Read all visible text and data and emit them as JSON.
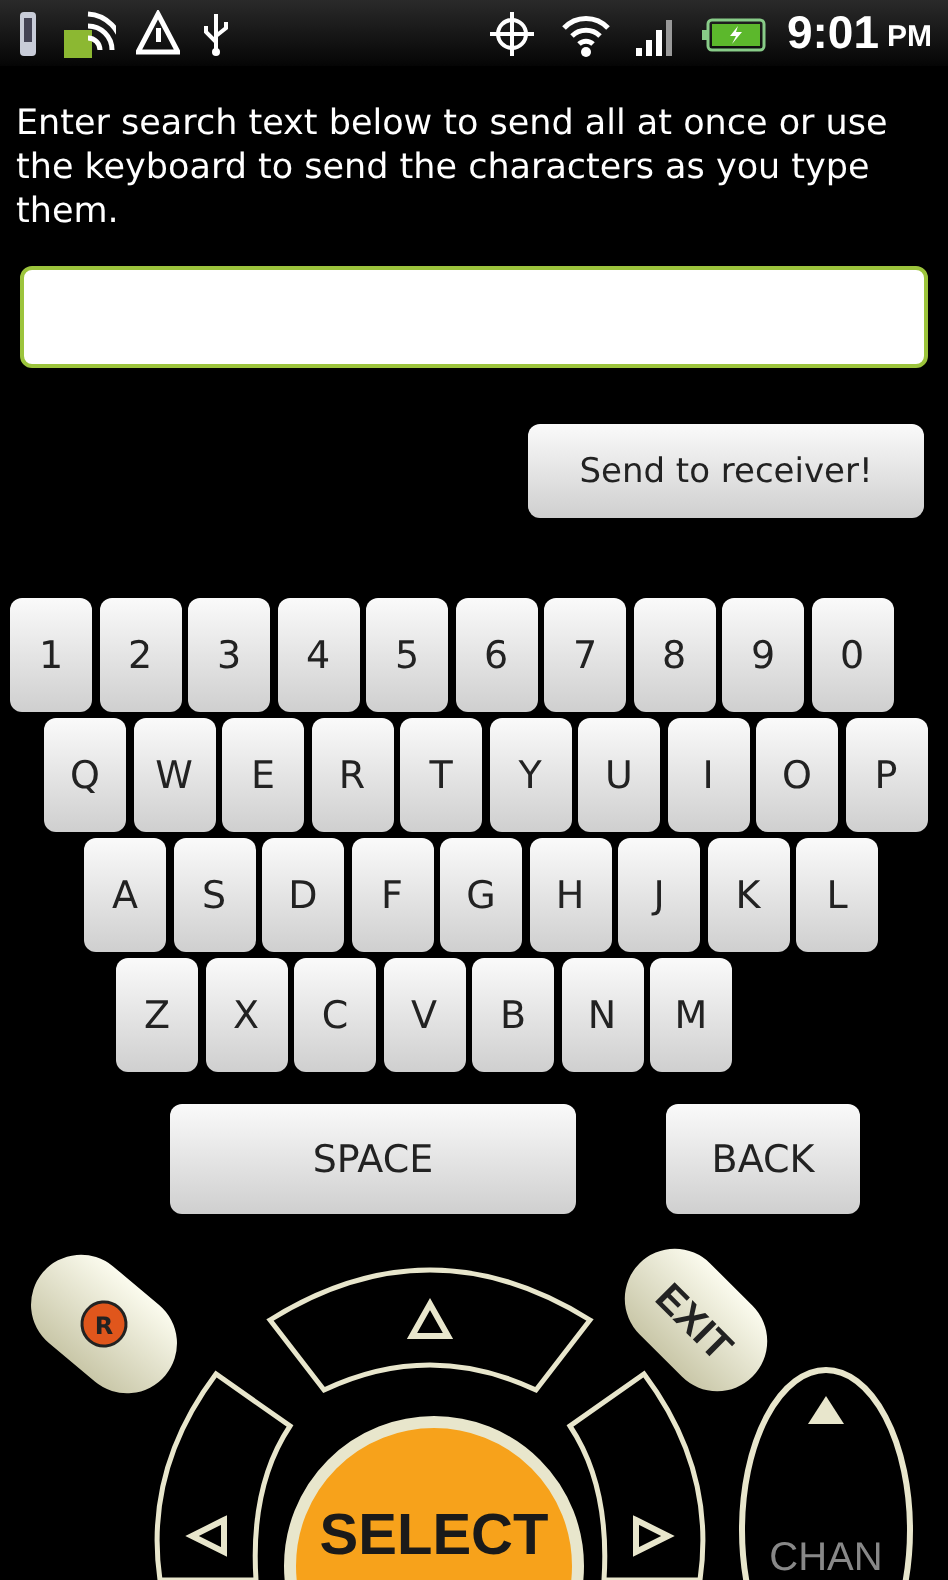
{
  "status_bar": {
    "time": "9:01",
    "period": "PM"
  },
  "instructions": "Enter search text below to send all at once or use the keyboard to send the characters as you type them.",
  "send_button": "Send to receiver!",
  "keyboard": {
    "rows": [
      [
        "1",
        "2",
        "3",
        "4",
        "5",
        "6",
        "7",
        "8",
        "9",
        "0"
      ],
      [
        "Q",
        "W",
        "E",
        "R",
        "T",
        "Y",
        "U",
        "I",
        "O",
        "P"
      ],
      [
        "A",
        "S",
        "D",
        "F",
        "G",
        "H",
        "J",
        "K",
        "L"
      ],
      [
        "Z",
        "X",
        "C",
        "V",
        "B",
        "N",
        "M"
      ]
    ],
    "space": "SPACE",
    "back": "BACK"
  },
  "remote": {
    "record": "R",
    "exit": "EXIT",
    "select": "SELECT",
    "channel": "CHAN"
  }
}
